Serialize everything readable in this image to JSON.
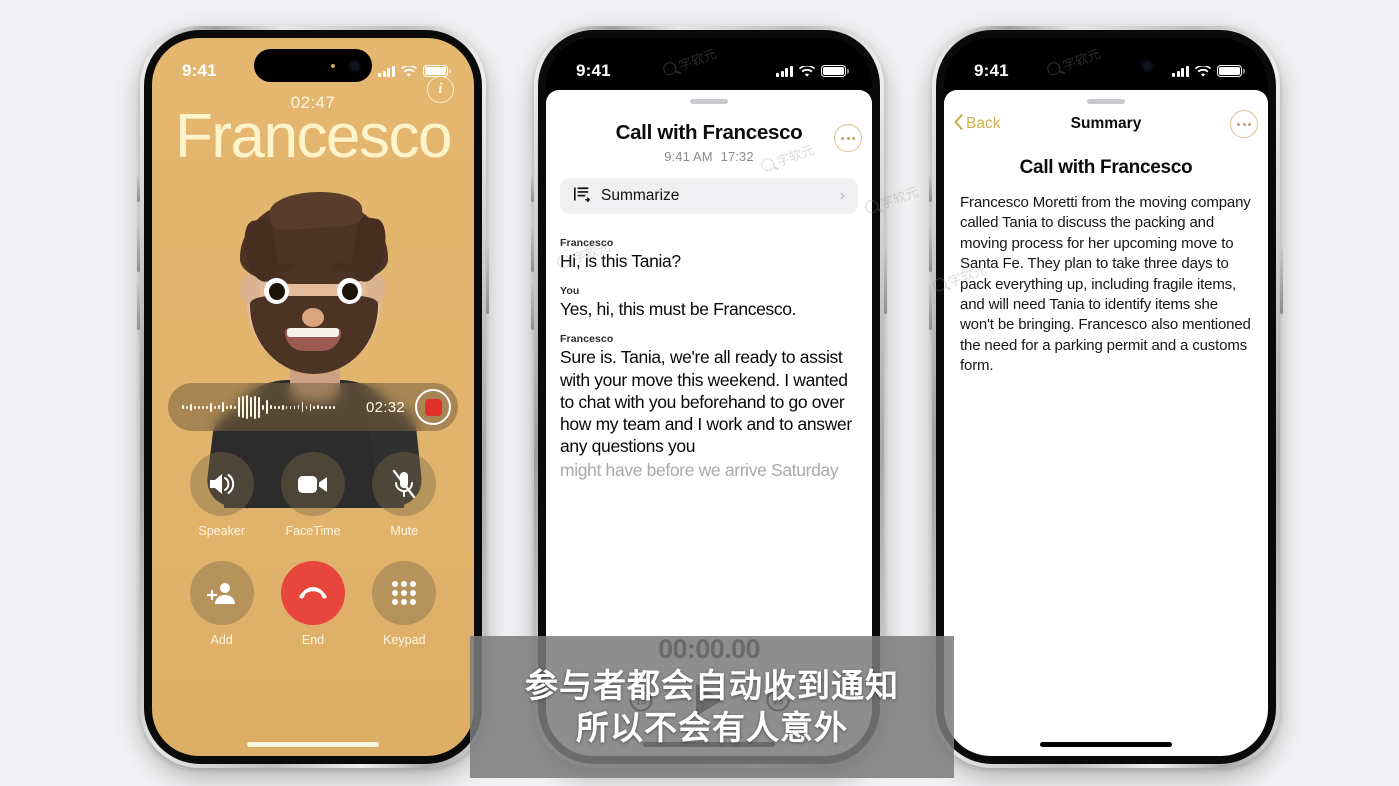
{
  "background_color": "#f2f2f4",
  "phone1": {
    "name": "call-screen",
    "status": {
      "time": "9:41"
    },
    "call": {
      "timer": "02:47",
      "contact_name": "Francesco",
      "info_icon": "info-icon",
      "recording": {
        "elapsed": "02:32",
        "record_icon": "record-stop-icon"
      },
      "controls": [
        {
          "label": "Speaker",
          "icon": "speaker-icon"
        },
        {
          "label": "FaceTime",
          "icon": "video-camera-icon"
        },
        {
          "label": "Mute",
          "icon": "microphone-muted-icon"
        },
        {
          "label": "Add",
          "icon": "add-person-icon"
        },
        {
          "label": "End",
          "icon": "end-call-icon"
        },
        {
          "label": "Keypad",
          "icon": "keypad-icon"
        }
      ]
    }
  },
  "phone2": {
    "name": "call-transcript-sheet",
    "status": {
      "time": "9:41"
    },
    "sheet": {
      "title": "Call with Francesco",
      "time": "9:41 AM",
      "duration": "17:32",
      "more_icon": "ellipsis-circle-icon",
      "summarize": {
        "label": "Summarize",
        "icon": "summarize-icon",
        "chevron": "chevron-right-icon"
      },
      "transcript": [
        {
          "speaker": "Francesco",
          "text": "Hi, is this Tania?",
          "faded": false
        },
        {
          "speaker": "You",
          "text": "Yes, hi, this must be Francesco.",
          "faded": false
        },
        {
          "speaker": "Francesco",
          "text": "Sure is. Tania, we're all ready to assist with your move this weekend. I wanted to chat with you beforehand to go over how my team and I work and to answer any questions you",
          "faded": false
        },
        {
          "speaker": "",
          "text": "might have before we arrive Saturday",
          "faded": true
        }
      ],
      "player": {
        "time": "00:00.00",
        "skip_back": "skip-back-15-icon",
        "skip_back_label": "15",
        "play": "play-icon",
        "skip_forward": "skip-forward-15-icon",
        "skip_forward_label": "15"
      }
    }
  },
  "phone3": {
    "name": "summary-screen",
    "status": {
      "time": "9:41"
    },
    "nav": {
      "back_label": "Back",
      "back_icon": "chevron-left-icon",
      "title": "Summary",
      "more_icon": "ellipsis-circle-icon"
    },
    "heading": "Call with Francesco",
    "body": "Francesco Moretti from the moving company called Tania to discuss the packing and moving process for her upcoming move to Santa Fe. They plan to take three days to pack everything up, including fragile items, and will need Tania to identify items she won't be bringing. Francesco also mentioned the need for a parking permit and a customs form."
  },
  "subtitle": {
    "line1": "参与者都会自动收到通知",
    "line2": "所以不会有人意外"
  },
  "watermark": {
    "text": "字软元"
  },
  "colors": {
    "call_bg": "#e2b56f",
    "call_name": "#fdf4c9",
    "end_red": "#e8453c",
    "gold": "#cfae4d",
    "record_red": "#e03027"
  }
}
